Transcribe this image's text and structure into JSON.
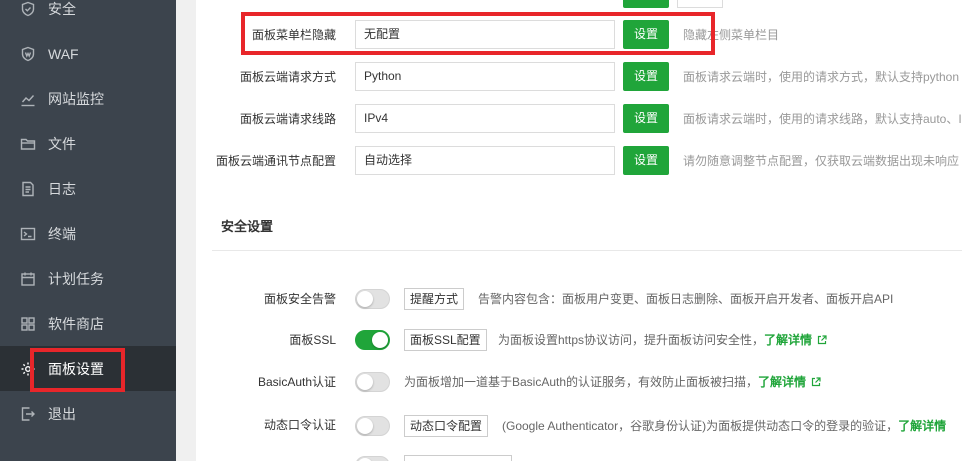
{
  "sidebar": {
    "items": [
      {
        "label": "安全",
        "icon": "shield-icon"
      },
      {
        "label": "WAF",
        "icon": "waf-shield-icon"
      },
      {
        "label": "网站监控",
        "icon": "chart-line-icon"
      },
      {
        "label": "文件",
        "icon": "folder-icon"
      },
      {
        "label": "日志",
        "icon": "log-document-icon"
      },
      {
        "label": "终端",
        "icon": "terminal-icon"
      },
      {
        "label": "计划任务",
        "icon": "calendar-icon"
      },
      {
        "label": "软件商店",
        "icon": "grid-apps-icon"
      },
      {
        "label": "面板设置",
        "icon": "gear-icon",
        "active": true
      },
      {
        "label": "退出",
        "icon": "logout-icon"
      }
    ]
  },
  "settings": [
    {
      "label": "面板菜单栏隐藏",
      "value": "无配置",
      "button": "设置",
      "hint": "隐藏左侧菜单栏目"
    },
    {
      "label": "面板云端请求方式",
      "value": "Python",
      "button": "设置",
      "hint": "面板请求云端时，使用的请求方式，默认支持python"
    },
    {
      "label": "面板云端请求线路",
      "value": "IPv4",
      "button": "设置",
      "hint": "面板请求云端时，使用的请求线路，默认支持auto、I"
    },
    {
      "label": "面板云端通讯节点配置",
      "value": "自动选择",
      "button": "设置",
      "hint": "请勿随意调整节点配置，仅获取云端数据出现未响应"
    }
  ],
  "security": {
    "title": "安全设置",
    "rows": [
      {
        "label": "面板安全告警",
        "on": false,
        "button": "提醒方式",
        "desc": "告警内容包含：面板用户变更、面板日志删除、面板开启开发者、面板开启API",
        "link": ""
      },
      {
        "label": "面板SSL",
        "on": true,
        "button": "面板SSL配置",
        "desc": "为面板设置https协议访问，提升面板访问安全性，",
        "link": "了解详情"
      },
      {
        "label": "BasicAuth认证",
        "on": false,
        "button": "",
        "desc": "为面板增加一道基于BasicAuth的认证服务，有效防止面板被扫描，",
        "link": "了解详情"
      },
      {
        "label": "动态口令认证",
        "on": false,
        "button": "动态口令配置",
        "desc": "(Google Authenticator，谷歌身份认证)为面板提供动态口令的登录的验证，",
        "link": "了解详情"
      }
    ]
  },
  "colors": {
    "accent": "#20a53a",
    "sidebar_bg": "#3c444d",
    "highlight": "#e8262a"
  }
}
